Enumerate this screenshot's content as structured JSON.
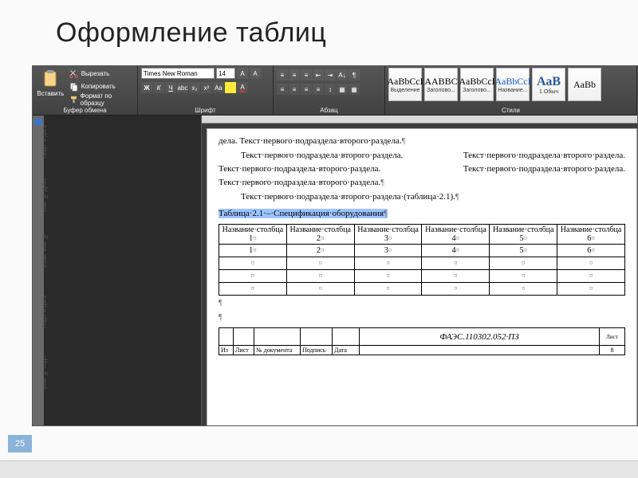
{
  "slide": {
    "title": "Оформление таблиц",
    "number": "25"
  },
  "ribbon": {
    "clipboard": {
      "label": "Буфер обмена",
      "paste": "Вставить",
      "cut": "Вырезать",
      "copy": "Копировать",
      "format_painter": "Формат по образцу"
    },
    "font": {
      "label": "Шрифт",
      "name": "Times New Roman",
      "size": "14"
    },
    "paragraph": {
      "label": "Абзац"
    },
    "styles": {
      "label": "Стили",
      "items": [
        {
          "sample": "AaBbCcI",
          "name": "Выделение"
        },
        {
          "sample": "AABBC",
          "name": "Заголово..."
        },
        {
          "sample": "AaBbCcI",
          "name": "Заголово..."
        },
        {
          "sample": "AaBbCcI",
          "name": "Название...",
          "blue": true
        },
        {
          "sample": "АаВ",
          "name": "1 Обыч",
          "big": true
        },
        {
          "sample": "AaBb",
          "name": ""
        }
      ]
    }
  },
  "margin_labels": [
    "Подп. и дата",
    "Инв. № дубл.",
    "Взам. инв. №",
    "Подп. и дата",
    "Инв. № подп."
  ],
  "doc": {
    "p1": "дела. Текст·первого·подраздела·второго·раздела.",
    "p2": "Текст·первого·подраздела·второго·раздела. Текст·первого·подраздела·второго·раздела. Текст·первого·подраздела·второго·раздела. Текст·первого·подраздела·второго·раздела. Текст·первого·подраздела·второго·раздела.",
    "p3": "Текст·первого·подраздела·второго·раздела·(таблица·2.1).",
    "caption": "Таблица·2.1·–·Спецификация·оборудования",
    "headers": [
      "Название·столбца 1",
      "Название·столбца 2",
      "Название·столбца 3",
      "Название·столбца 4",
      "Название·столбца 5",
      "Название·столбца 6"
    ],
    "row1": [
      "1",
      "2",
      "3",
      "4",
      "5",
      "6"
    ]
  },
  "stamp": {
    "cells": [
      "Из",
      "Лист",
      "№ документа",
      "Подпись",
      "Дата"
    ],
    "code": "ФАЭС.110302.052·ПЗ",
    "sheet_label": "Лист",
    "sheet_no": "8"
  }
}
